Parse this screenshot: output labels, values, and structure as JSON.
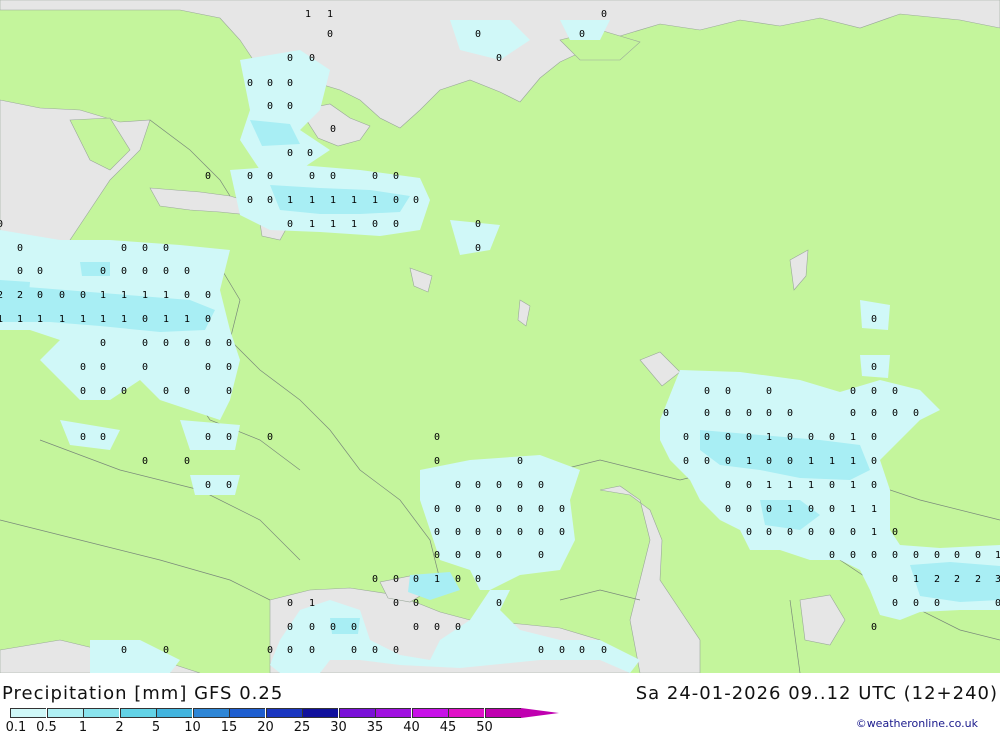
{
  "footer": {
    "title": "Precipitation [mm] GFS 0.25",
    "datetime": "Sa 24-01-2026 09..12 UTC (12+240)",
    "credit": "©weatheronline.co.uk"
  },
  "legend": {
    "ticks": [
      "0.1",
      "0.5",
      "1",
      "2",
      "5",
      "10",
      "15",
      "20",
      "25",
      "30",
      "35",
      "40",
      "45",
      "50"
    ],
    "colors": [
      "#d0f8f8",
      "#b0f0f4",
      "#8ae4ee",
      "#62d2e6",
      "#42b4de",
      "#2e86d6",
      "#1e5ed0",
      "#1a36c0",
      "#10109c",
      "#7a10d8",
      "#a010e0",
      "#c810e8",
      "#e010c8",
      "#c000b0"
    ]
  },
  "map_colors": {
    "land": "#c4f59c",
    "sea": "#e6e6e6",
    "precip_light": "#d0f8f8",
    "precip_medium": "#a8eef4",
    "border": "#7a8a7a"
  },
  "values": [
    [
      "1",
      308,
      13
    ],
    [
      "1",
      330,
      13
    ],
    [
      "0",
      330,
      33
    ],
    [
      "0",
      604,
      13
    ],
    [
      "0",
      478,
      33
    ],
    [
      "0",
      582,
      33
    ],
    [
      "0",
      499,
      57
    ],
    [
      "0",
      290,
      57
    ],
    [
      "0",
      312,
      57
    ],
    [
      "0",
      250,
      82
    ],
    [
      "0",
      270,
      82
    ],
    [
      "0",
      290,
      82
    ],
    [
      "0",
      270,
      105
    ],
    [
      "0",
      290,
      105
    ],
    [
      "0",
      333,
      128
    ],
    [
      "0",
      290,
      152
    ],
    [
      "0",
      310,
      152
    ],
    [
      "0",
      208,
      175
    ],
    [
      "0",
      250,
      175
    ],
    [
      "0",
      270,
      175
    ],
    [
      "0",
      312,
      175
    ],
    [
      "0",
      333,
      175
    ],
    [
      "0",
      375,
      175
    ],
    [
      "0",
      396,
      175
    ],
    [
      "0",
      250,
      199
    ],
    [
      "0",
      270,
      199
    ],
    [
      "1",
      290,
      199
    ],
    [
      "1",
      312,
      199
    ],
    [
      "1",
      333,
      199
    ],
    [
      "1",
      354,
      199
    ],
    [
      "1",
      375,
      199
    ],
    [
      "0",
      396,
      199
    ],
    [
      "0",
      416,
      199
    ],
    [
      "0",
      290,
      223
    ],
    [
      "1",
      312,
      223
    ],
    [
      "1",
      333,
      223
    ],
    [
      "1",
      354,
      223
    ],
    [
      "0",
      375,
      223
    ],
    [
      "0",
      396,
      223
    ],
    [
      "0",
      478,
      223
    ],
    [
      "0",
      478,
      247
    ],
    [
      "0",
      0,
      223
    ],
    [
      "0",
      20,
      247
    ],
    [
      "0",
      124,
      247
    ],
    [
      "0",
      145,
      247
    ],
    [
      "0",
      166,
      247
    ],
    [
      "0",
      20,
      270
    ],
    [
      "0",
      40,
      270
    ],
    [
      "0",
      103,
      270
    ],
    [
      "0",
      124,
      270
    ],
    [
      "0",
      145,
      270
    ],
    [
      "0",
      166,
      270
    ],
    [
      "0",
      187,
      270
    ],
    [
      "2",
      0,
      294
    ],
    [
      "2",
      20,
      294
    ],
    [
      "0",
      40,
      294
    ],
    [
      "0",
      62,
      294
    ],
    [
      "0",
      83,
      294
    ],
    [
      "1",
      103,
      294
    ],
    [
      "1",
      124,
      294
    ],
    [
      "1",
      145,
      294
    ],
    [
      "1",
      166,
      294
    ],
    [
      "0",
      187,
      294
    ],
    [
      "0",
      208,
      294
    ],
    [
      "1",
      0,
      318
    ],
    [
      "1",
      20,
      318
    ],
    [
      "1",
      40,
      318
    ],
    [
      "1",
      62,
      318
    ],
    [
      "1",
      83,
      318
    ],
    [
      "1",
      103,
      318
    ],
    [
      "1",
      124,
      318
    ],
    [
      "0",
      145,
      318
    ],
    [
      "1",
      166,
      318
    ],
    [
      "1",
      187,
      318
    ],
    [
      "0",
      208,
      318
    ],
    [
      "0",
      103,
      342
    ],
    [
      "0",
      145,
      342
    ],
    [
      "0",
      166,
      342
    ],
    [
      "0",
      187,
      342
    ],
    [
      "0",
      208,
      342
    ],
    [
      "0",
      229,
      342
    ],
    [
      "0",
      83,
      366
    ],
    [
      "0",
      103,
      366
    ],
    [
      "0",
      145,
      366
    ],
    [
      "0",
      208,
      366
    ],
    [
      "0",
      229,
      366
    ],
    [
      "0",
      83,
      390
    ],
    [
      "0",
      103,
      390
    ],
    [
      "0",
      124,
      390
    ],
    [
      "0",
      166,
      390
    ],
    [
      "0",
      187,
      390
    ],
    [
      "0",
      229,
      390
    ],
    [
      "0",
      83,
      436
    ],
    [
      "0",
      103,
      436
    ],
    [
      "0",
      208,
      436
    ],
    [
      "0",
      229,
      436
    ],
    [
      "0",
      270,
      436
    ],
    [
      "0",
      145,
      460
    ],
    [
      "0",
      187,
      460
    ],
    [
      "0",
      208,
      484
    ],
    [
      "0",
      229,
      484
    ],
    [
      "0",
      437,
      436
    ],
    [
      "0",
      437,
      460
    ],
    [
      "0",
      520,
      460
    ],
    [
      "0",
      458,
      484
    ],
    [
      "0",
      478,
      484
    ],
    [
      "0",
      499,
      484
    ],
    [
      "0",
      520,
      484
    ],
    [
      "0",
      541,
      484
    ],
    [
      "0",
      437,
      508
    ],
    [
      "0",
      458,
      508
    ],
    [
      "0",
      478,
      508
    ],
    [
      "0",
      499,
      508
    ],
    [
      "0",
      520,
      508
    ],
    [
      "0",
      541,
      508
    ],
    [
      "0",
      562,
      508
    ],
    [
      "0",
      437,
      531
    ],
    [
      "0",
      458,
      531
    ],
    [
      "0",
      478,
      531
    ],
    [
      "0",
      499,
      531
    ],
    [
      "0",
      520,
      531
    ],
    [
      "0",
      541,
      531
    ],
    [
      "0",
      562,
      531
    ],
    [
      "0",
      437,
      554
    ],
    [
      "0",
      458,
      554
    ],
    [
      "0",
      478,
      554
    ],
    [
      "0",
      499,
      554
    ],
    [
      "0",
      541,
      554
    ],
    [
      "0",
      375,
      578
    ],
    [
      "0",
      396,
      578
    ],
    [
      "0",
      416,
      578
    ],
    [
      "1",
      437,
      578
    ],
    [
      "0",
      458,
      578
    ],
    [
      "0",
      478,
      578
    ],
    [
      "0",
      290,
      602
    ],
    [
      "1",
      312,
      602
    ],
    [
      "0",
      396,
      602
    ],
    [
      "0",
      416,
      602
    ],
    [
      "0",
      499,
      602
    ],
    [
      "0",
      290,
      626
    ],
    [
      "0",
      312,
      626
    ],
    [
      "0",
      333,
      626
    ],
    [
      "0",
      354,
      626
    ],
    [
      "0",
      416,
      626
    ],
    [
      "0",
      437,
      626
    ],
    [
      "0",
      458,
      626
    ],
    [
      "0",
      124,
      649
    ],
    [
      "0",
      166,
      649
    ],
    [
      "0",
      270,
      649
    ],
    [
      "0",
      290,
      649
    ],
    [
      "0",
      312,
      649
    ],
    [
      "0",
      354,
      649
    ],
    [
      "0",
      375,
      649
    ],
    [
      "0",
      396,
      649
    ],
    [
      "0",
      541,
      649
    ],
    [
      "0",
      562,
      649
    ],
    [
      "0",
      582,
      649
    ],
    [
      "0",
      604,
      649
    ],
    [
      "0",
      874,
      318
    ],
    [
      "0",
      874,
      366
    ],
    [
      "0",
      707,
      390
    ],
    [
      "0",
      728,
      390
    ],
    [
      "0",
      769,
      390
    ],
    [
      "0",
      853,
      390
    ],
    [
      "0",
      874,
      390
    ],
    [
      "0",
      895,
      390
    ],
    [
      "0",
      666,
      412
    ],
    [
      "0",
      707,
      412
    ],
    [
      "0",
      728,
      412
    ],
    [
      "0",
      749,
      412
    ],
    [
      "0",
      769,
      412
    ],
    [
      "0",
      790,
      412
    ],
    [
      "0",
      853,
      412
    ],
    [
      "0",
      874,
      412
    ],
    [
      "0",
      895,
      412
    ],
    [
      "0",
      916,
      412
    ],
    [
      "0",
      686,
      436
    ],
    [
      "0",
      707,
      436
    ],
    [
      "0",
      728,
      436
    ],
    [
      "0",
      749,
      436
    ],
    [
      "1",
      769,
      436
    ],
    [
      "0",
      790,
      436
    ],
    [
      "0",
      811,
      436
    ],
    [
      "0",
      832,
      436
    ],
    [
      "1",
      853,
      436
    ],
    [
      "0",
      874,
      436
    ],
    [
      "0",
      686,
      460
    ],
    [
      "0",
      707,
      460
    ],
    [
      "0",
      728,
      460
    ],
    [
      "1",
      749,
      460
    ],
    [
      "0",
      769,
      460
    ],
    [
      "0",
      790,
      460
    ],
    [
      "1",
      811,
      460
    ],
    [
      "1",
      832,
      460
    ],
    [
      "1",
      853,
      460
    ],
    [
      "0",
      874,
      460
    ],
    [
      "0",
      728,
      484
    ],
    [
      "0",
      749,
      484
    ],
    [
      "1",
      769,
      484
    ],
    [
      "1",
      790,
      484
    ],
    [
      "1",
      811,
      484
    ],
    [
      "0",
      832,
      484
    ],
    [
      "1",
      853,
      484
    ],
    [
      "0",
      874,
      484
    ],
    [
      "0",
      728,
      508
    ],
    [
      "0",
      749,
      508
    ],
    [
      "0",
      769,
      508
    ],
    [
      "1",
      790,
      508
    ],
    [
      "0",
      811,
      508
    ],
    [
      "0",
      832,
      508
    ],
    [
      "1",
      853,
      508
    ],
    [
      "1",
      874,
      508
    ],
    [
      "0",
      749,
      531
    ],
    [
      "0",
      769,
      531
    ],
    [
      "0",
      790,
      531
    ],
    [
      "0",
      811,
      531
    ],
    [
      "0",
      832,
      531
    ],
    [
      "0",
      853,
      531
    ],
    [
      "1",
      874,
      531
    ],
    [
      "0",
      895,
      531
    ],
    [
      "0",
      832,
      554
    ],
    [
      "0",
      853,
      554
    ],
    [
      "0",
      874,
      554
    ],
    [
      "0",
      895,
      554
    ],
    [
      "0",
      916,
      554
    ],
    [
      "0",
      937,
      554
    ],
    [
      "0",
      957,
      554
    ],
    [
      "0",
      978,
      554
    ],
    [
      "1",
      998,
      554
    ],
    [
      "0",
      895,
      578
    ],
    [
      "1",
      916,
      578
    ],
    [
      "2",
      937,
      578
    ],
    [
      "2",
      957,
      578
    ],
    [
      "2",
      978,
      578
    ],
    [
      "3",
      998,
      578
    ],
    [
      "0",
      895,
      602
    ],
    [
      "0",
      916,
      602
    ],
    [
      "0",
      937,
      602
    ],
    [
      "0",
      998,
      602
    ],
    [
      "0",
      874,
      626
    ]
  ]
}
